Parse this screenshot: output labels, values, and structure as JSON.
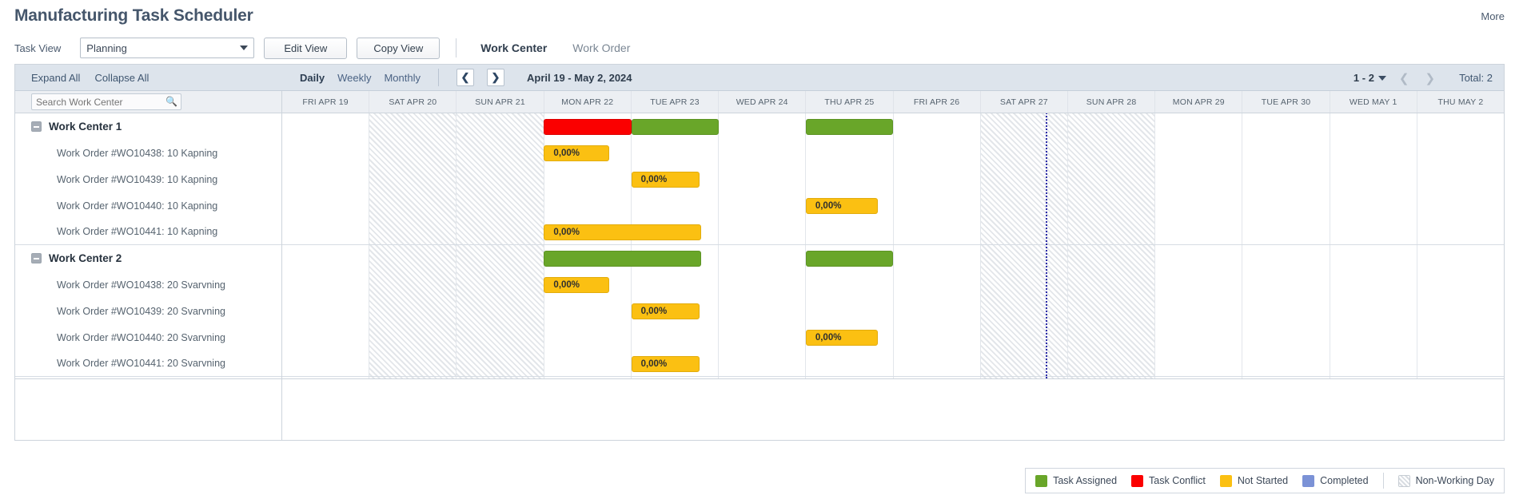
{
  "header": {
    "title": "Manufacturing Task Scheduler",
    "more_label": "More"
  },
  "toolbar": {
    "task_view_label": "Task View",
    "view_select": {
      "value": "Planning",
      "options": [
        "Planning"
      ]
    },
    "edit_view_label": "Edit View",
    "copy_view_label": "Copy View",
    "tabs": [
      {
        "label": "Work Center",
        "active": true
      },
      {
        "label": "Work Order",
        "active": false
      }
    ]
  },
  "control_bar": {
    "expand_all_label": "Expand All",
    "collapse_all_label": "Collapse All",
    "zoom_levels": [
      {
        "label": "Daily",
        "active": true
      },
      {
        "label": "Weekly",
        "active": false
      },
      {
        "label": "Monthly",
        "active": false
      }
    ],
    "prev_icon": "chevron-left-icon",
    "next_icon": "chevron-right-icon",
    "date_range": "April 19 - May 2, 2024",
    "page_range": "1 - 2",
    "page_prev_icon": "chevron-left-icon",
    "page_next_icon": "chevron-right-icon",
    "total_label": "Total: 2"
  },
  "search": {
    "placeholder": "Search Work Center",
    "value": "",
    "icon": "search-icon"
  },
  "timeline": {
    "days": [
      {
        "label": "FRI APR 19",
        "nonworking": false
      },
      {
        "label": "SAT APR 20",
        "nonworking": true
      },
      {
        "label": "SUN APR 21",
        "nonworking": true
      },
      {
        "label": "MON APR 22",
        "nonworking": false
      },
      {
        "label": "TUE APR 23",
        "nonworking": false
      },
      {
        "label": "WED APR 24",
        "nonworking": false
      },
      {
        "label": "THU APR 25",
        "nonworking": false
      },
      {
        "label": "FRI APR 26",
        "nonworking": false
      },
      {
        "label": "SAT APR 27",
        "nonworking": true
      },
      {
        "label": "SUN APR 28",
        "nonworking": true
      },
      {
        "label": "MON APR 29",
        "nonworking": false
      },
      {
        "label": "TUE APR 30",
        "nonworking": false
      },
      {
        "label": "WED MAY 1",
        "nonworking": false
      },
      {
        "label": "THU MAY 2",
        "nonworking": false
      }
    ],
    "today_marker_day_index": 8.75
  },
  "rows": [
    {
      "type": "group",
      "label": "Work Center 1",
      "toggle_icon": "collapse-minus-icon",
      "bars": [
        {
          "color": "red",
          "start": 3,
          "span": 1,
          "label": ""
        },
        {
          "color": "green",
          "start": 4,
          "span": 1,
          "label": ""
        },
        {
          "color": "green",
          "start": 6,
          "span": 1,
          "label": ""
        }
      ]
    },
    {
      "type": "task",
      "label": "Work Order #WO10438: 10 Kapning",
      "bars": [
        {
          "color": "yellow",
          "start": 3,
          "span": 0.75,
          "label": "0,00%"
        }
      ]
    },
    {
      "type": "task",
      "label": "Work Order #WO10439: 10 Kapning",
      "bars": [
        {
          "color": "yellow",
          "start": 4,
          "span": 0.78,
          "label": "0,00%"
        }
      ]
    },
    {
      "type": "task",
      "label": "Work Order #WO10440: 10 Kapning",
      "bars": [
        {
          "color": "yellow",
          "start": 6,
          "span": 0.83,
          "label": "0,00%"
        }
      ]
    },
    {
      "type": "task",
      "label": "Work Order #WO10441: 10 Kapning",
      "bars": [
        {
          "color": "yellow",
          "start": 3,
          "span": 1.8,
          "label": "0,00%"
        }
      ],
      "group_end": true
    },
    {
      "type": "group",
      "label": "Work Center 2",
      "toggle_icon": "collapse-minus-icon",
      "bars": [
        {
          "color": "green",
          "start": 3,
          "span": 1.8,
          "label": ""
        },
        {
          "color": "green",
          "start": 6,
          "span": 1,
          "label": ""
        }
      ]
    },
    {
      "type": "task",
      "label": "Work Order #WO10438: 20 Svarvning",
      "bars": [
        {
          "color": "yellow",
          "start": 3,
          "span": 0.75,
          "label": "0,00%"
        }
      ]
    },
    {
      "type": "task",
      "label": "Work Order #WO10439: 20 Svarvning",
      "bars": [
        {
          "color": "yellow",
          "start": 4,
          "span": 0.78,
          "label": "0,00%"
        }
      ]
    },
    {
      "type": "task",
      "label": "Work Order #WO10440: 20 Svarvning",
      "bars": [
        {
          "color": "yellow",
          "start": 6,
          "span": 0.83,
          "label": "0,00%"
        }
      ]
    },
    {
      "type": "task",
      "label": "Work Order #WO10441: 20 Svarvning",
      "bars": [
        {
          "color": "yellow",
          "start": 4,
          "span": 0.78,
          "label": "0,00%"
        }
      ],
      "group_end": true
    }
  ],
  "legend": {
    "items": [
      {
        "label": "Task Assigned",
        "color": "#69a629"
      },
      {
        "label": "Task Conflict",
        "color": "#fb0000"
      },
      {
        "label": "Not Started",
        "color": "#fbc012"
      },
      {
        "label": "Completed",
        "color": "#7b92d6"
      }
    ],
    "nonworking": {
      "label": "Non-Working Day",
      "color": "#ffffff"
    }
  }
}
